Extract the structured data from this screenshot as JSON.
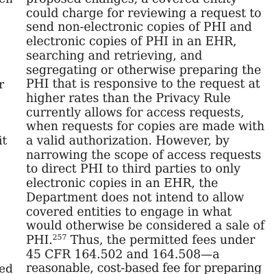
{
  "left_margin": {
    "fragments": [
      "en",
      "r",
      "it",
      "ed"
    ]
  },
  "document": {
    "lines": [
      "proposed changes, a covered entity",
      "could charge for reviewing a request to",
      "send non-electronic copies of PHI and",
      "electronic copies of PHI in an EHR,",
      "searching and retrieving, and",
      "segregating or otherwise preparing the",
      "PHI that is responsive to the request at",
      "higher rates than the Privacy Rule",
      "currently allows for access requests,",
      "when requests for copies are made with",
      "a valid authorization. However, by",
      "narrowing the scope of access requests",
      "to direct PHI to third parties to only",
      "electronic copies in an EHR, the",
      "Department does not intend to allow",
      "covered entities to engage in what",
      "would otherwise be considered a sale of"
    ],
    "footnote_line": {
      "before": "PHI.",
      "footnote_ref": "257",
      "after": " Thus, the permitted fees under"
    },
    "lines_after": [
      "45 CFR 164.502 and 164.508—a",
      "reasonable, cost-based fee for preparing"
    ]
  }
}
